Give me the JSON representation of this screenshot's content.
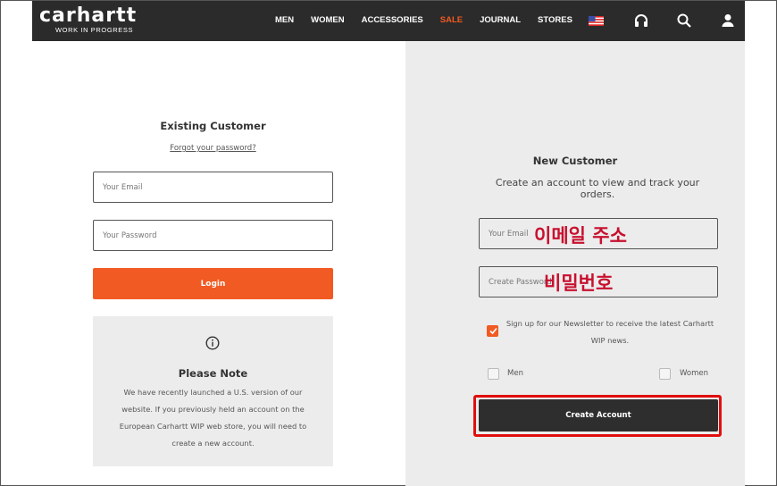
{
  "header": {
    "logo_main": "carhartt",
    "logo_sub": "WORK IN PROGRESS",
    "nav": [
      {
        "label": "MEN"
      },
      {
        "label": "WOMEN"
      },
      {
        "label": "ACCESSORIES"
      },
      {
        "label": "SALE"
      },
      {
        "label": "JOURNAL"
      },
      {
        "label": "STORES"
      }
    ],
    "icons": [
      "us-flag-icon",
      "headphones-icon",
      "search-icon",
      "user-icon"
    ]
  },
  "existing": {
    "title": "Existing Customer",
    "forgot": "Forgot your password?",
    "email_placeholder": "Your Email",
    "password_placeholder": "Your Password",
    "login_label": "Login"
  },
  "note": {
    "icon": "info-icon",
    "title": "Please Note",
    "text": "We have recently launched a U.S. version of our website. If you previously held an account on the European Carhartt WIP web store, you will need to create a new account."
  },
  "new_customer": {
    "title": "New Customer",
    "subtitle": "Create an account to view and track your orders.",
    "email_placeholder": "Your Email",
    "password_placeholder": "Create Password",
    "email_annotation": "이메일 주소",
    "password_annotation": "비밀번호",
    "newsletter_text": "Sign up for our Newsletter to receive the latest Carhartt WIP news.",
    "newsletter_checked": true,
    "gender_men": "Men",
    "gender_women": "Women",
    "create_label": "Create Account"
  },
  "colors": {
    "accent": "#f15a22",
    "header_bg": "#2b2b2b",
    "highlight_red": "#e10e0e",
    "annotation_red": "#c8102e",
    "panel_bg": "#ececec"
  }
}
